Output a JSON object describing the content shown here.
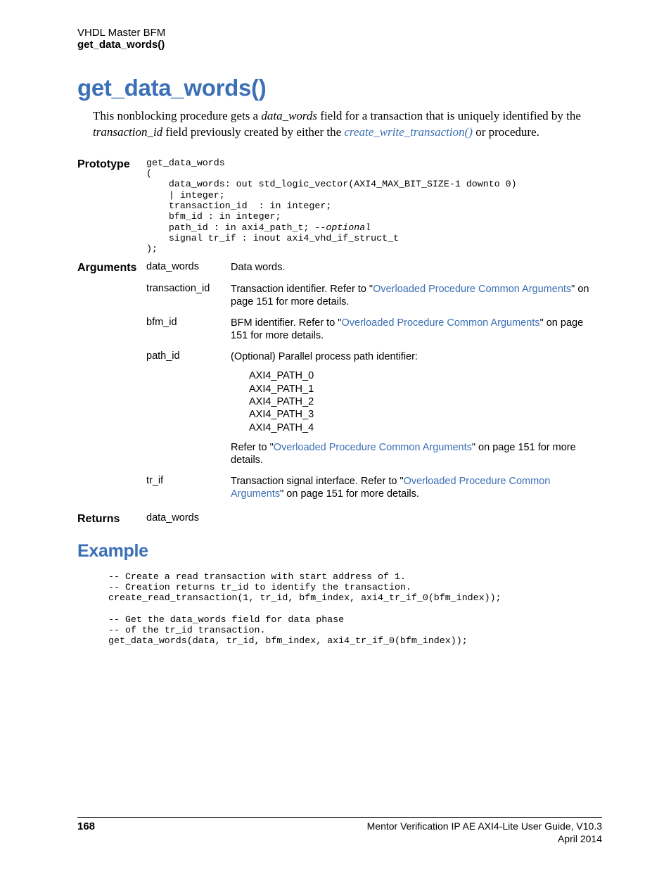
{
  "header": {
    "line1": "VHDL Master BFM",
    "line2": "get_data_words()"
  },
  "title": "get_data_words()",
  "intro": {
    "pre1": "This nonblocking procedure gets a ",
    "em1": "data_words",
    "mid1": " field for a transaction that is uniquely identified by the ",
    "em2": "transaction_id",
    "mid2": " field previously created by either the ",
    "link1": "create_write_transaction()",
    "post1": " or procedure."
  },
  "prototype": {
    "label": "Prototype",
    "code_line1": "get_data_words",
    "code_line2": "(",
    "code_line3": "    data_words: out std_logic_vector(AXI4_MAX_BIT_SIZE-1 downto 0)",
    "code_line4": "    | integer;",
    "code_line5": "    transaction_id  : in integer;",
    "code_line6": "    bfm_id : in integer;",
    "code_line7a": "    path_id : in axi4_path_t; ",
    "code_line7b": "--optional",
    "code_line8": "    signal tr_if : inout axi4_vhd_if_struct_t",
    "code_line9": ");"
  },
  "arguments": {
    "label": "Arguments",
    "rows": [
      {
        "name": "data_words",
        "desc_pre": "Data words."
      },
      {
        "name": "transaction_id",
        "desc_pre": "Transaction identifier. Refer to \"",
        "link": "Overloaded Procedure Common Arguments",
        "desc_post": "\" on page 151 for more details."
      },
      {
        "name": "bfm_id",
        "desc_pre": "BFM identifier. Refer to \"",
        "link": "Overloaded Procedure Common Arguments",
        "desc_post": "\" on page 151 for more details."
      },
      {
        "name": "path_id",
        "desc_pre": "(Optional) Parallel process path identifier:",
        "paths": [
          "AXI4_PATH_0",
          "AXI4_PATH_1",
          "AXI4_PATH_2",
          "AXI4_PATH_3",
          "AXI4_PATH_4"
        ],
        "refer_pre": "Refer to \"",
        "refer_link": "Overloaded Procedure Common Arguments",
        "refer_post": "\" on page 151 for more details."
      },
      {
        "name": "tr_if",
        "desc_pre": "Transaction signal interface. Refer to \"",
        "link": "Overloaded Procedure Common Arguments",
        "desc_post": "\" on page 151 for more details."
      }
    ]
  },
  "returns": {
    "label": "Returns",
    "value": "data_words"
  },
  "example": {
    "heading": "Example",
    "code": "-- Create a read transaction with start address of 1.\n-- Creation returns tr_id to identify the transaction.\ncreate_read_transaction(1, tr_id, bfm_index, axi4_tr_if_0(bfm_index));\n\n-- Get the data_words field for data phase\n-- of the tr_id transaction.\nget_data_words(data, tr_id, bfm_index, axi4_tr_if_0(bfm_index));"
  },
  "footer": {
    "page": "168",
    "doc": "Mentor Verification IP AE AXI4-Lite User Guide, V10.3",
    "date": "April 2014"
  }
}
